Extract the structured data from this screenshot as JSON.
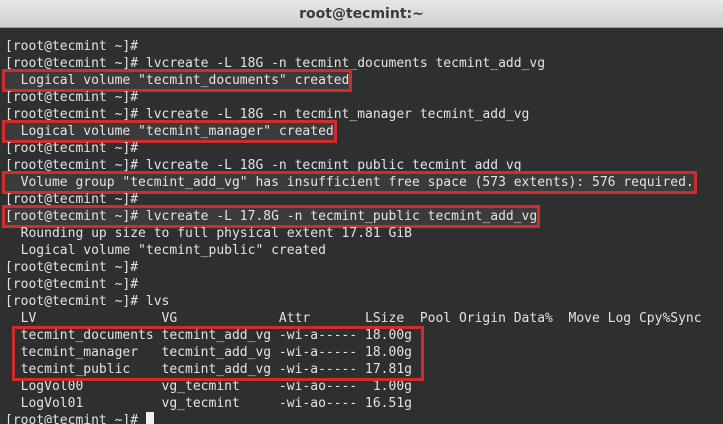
{
  "window": {
    "title": "root@tecmint:~"
  },
  "terminal": {
    "lines": [
      "[root@tecmint ~]#",
      "[root@tecmint ~]# lvcreate -L 18G -n tecmint_documents tecmint_add_vg",
      "  Logical volume \"tecmint_documents\" created",
      "[root@tecmint ~]#",
      "[root@tecmint ~]# lvcreate -L 18G -n tecmint_manager tecmint_add_vg",
      "  Logical volume \"tecmint_manager\" created",
      "[root@tecmint ~]#",
      "[root@tecmint ~]# lvcreate -L 18G -n tecmint_public tecmint_add_vg",
      "  Volume group \"tecmint_add_vg\" has insufficient free space (573 extents): 576 required.",
      "[root@tecmint ~]#",
      "[root@tecmint ~]# lvcreate -L 17.8G -n tecmint_public tecmint_add_vg",
      "  Rounding up size to full physical extent 17.81 GiB",
      "  Logical volume \"tecmint_public\" created",
      "[root@tecmint ~]#",
      "[root@tecmint ~]#",
      "[root@tecmint ~]# lvs",
      "  LV                VG             Attr       LSize  Pool Origin Data%  Move Log Cpy%Sync",
      "  tecmint_documents tecmint_add_vg -wi-a----- 18.00g",
      "  tecmint_manager   tecmint_add_vg -wi-a----- 18.00g",
      "  tecmint_public    tecmint_add_vg -wi-a----- 17.81g",
      "  LogVol00          vg_tecmint     -wi-ao----  1.00g",
      "  LogVol01          vg_tecmint     -wi-ao---- 16.51g",
      "[root@tecmint ~]#"
    ]
  },
  "highlight_color": "#d32a2a"
}
